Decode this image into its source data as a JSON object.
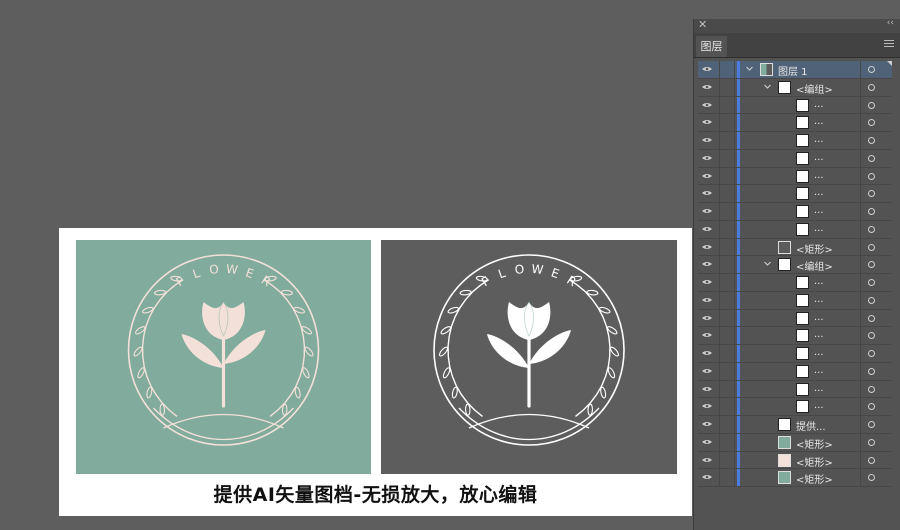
{
  "artwork": {
    "emblem_word": "FLOWER",
    "caption": "提供AI矢量图档-无损放大，放心编辑",
    "colors": {
      "teal": "#80ab9d",
      "dark": "#5d5d5d",
      "blush": "#f3e1d9",
      "white": "#ffffff"
    }
  },
  "panel": {
    "close_glyph": "✕",
    "collapse_glyph": "‹‹",
    "tab": "图层",
    "accent": "#4a7bde",
    "selected_row_color": "#4f6277",
    "layers": [
      {
        "label": "图层 1",
        "depth": 0,
        "expander": "open",
        "thumb": "layer",
        "selected": true
      },
      {
        "label": "<编组>",
        "depth": 1,
        "expander": "open",
        "thumb": "white"
      },
      {
        "label": "...",
        "depth": 2,
        "thumb": "white"
      },
      {
        "label": "...",
        "depth": 2,
        "thumb": "white"
      },
      {
        "label": "...",
        "depth": 2,
        "thumb": "white"
      },
      {
        "label": "...",
        "depth": 2,
        "thumb": "white"
      },
      {
        "label": "...",
        "depth": 2,
        "thumb": "white"
      },
      {
        "label": "...",
        "depth": 2,
        "thumb": "white"
      },
      {
        "label": "...",
        "depth": 2,
        "thumb": "white"
      },
      {
        "label": "...",
        "depth": 2,
        "thumb": "white"
      },
      {
        "label": "<矩形>",
        "depth": 1,
        "thumb": "dark"
      },
      {
        "label": "<编组>",
        "depth": 1,
        "expander": "open",
        "thumb": "white"
      },
      {
        "label": "...",
        "depth": 2,
        "thumb": "white"
      },
      {
        "label": "...",
        "depth": 2,
        "thumb": "white"
      },
      {
        "label": "...",
        "depth": 2,
        "thumb": "white"
      },
      {
        "label": "...",
        "depth": 2,
        "thumb": "white"
      },
      {
        "label": "...",
        "depth": 2,
        "thumb": "white"
      },
      {
        "label": "...",
        "depth": 2,
        "thumb": "white"
      },
      {
        "label": "...",
        "depth": 2,
        "thumb": "white"
      },
      {
        "label": "...",
        "depth": 2,
        "thumb": "white"
      },
      {
        "label": "提供...",
        "depth": 1,
        "thumb": "white"
      },
      {
        "label": "<矩形>",
        "depth": 1,
        "thumb": "green"
      },
      {
        "label": "<矩形>",
        "depth": 1,
        "thumb": "pink"
      },
      {
        "label": "<矩形>",
        "depth": 1,
        "thumb": "green"
      }
    ]
  }
}
